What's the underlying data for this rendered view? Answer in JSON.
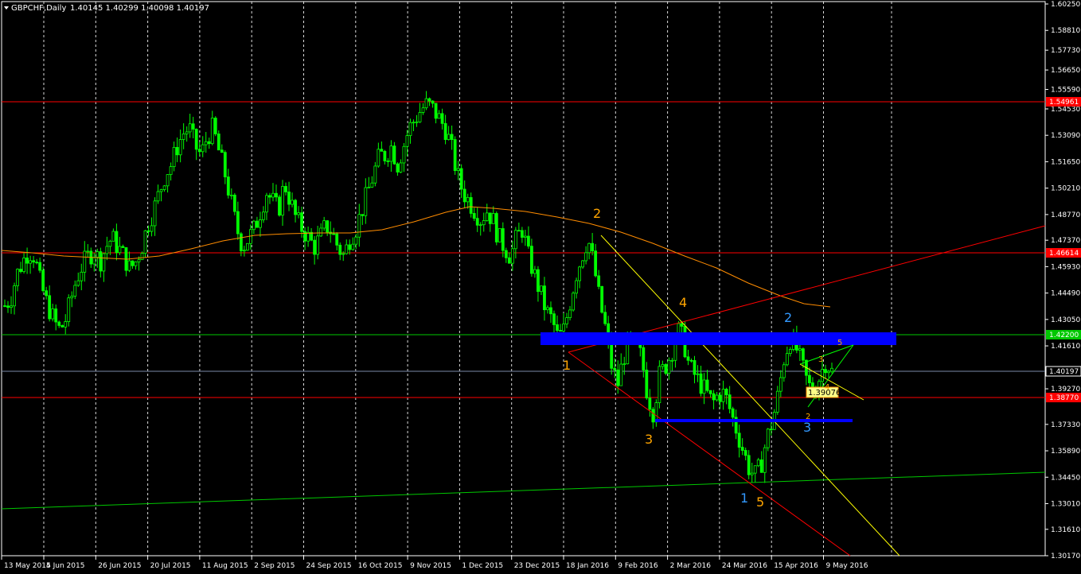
{
  "header": {
    "symbol_label": "GBPCHF,Daily",
    "ohlc": "1.40145 1.40299 1.40098 1.40197"
  },
  "colors": {
    "background": "#000000",
    "grid": "#ffffff",
    "candle": "#00ff00",
    "red_line": "#ff0000",
    "green_line": "#00c800",
    "yellow_line": "#ffff00",
    "ma_line": "#ff8c00",
    "blue_zone": "#0000ff",
    "wave_orange": "#ffa500",
    "wave_blue": "#3399ff",
    "current_price_line": "#7a8aa8"
  },
  "chart_data": {
    "type": "candlestick",
    "symbol": "GBPCHF",
    "timeframe": "Daily",
    "ohlc_last": {
      "open": 1.40145,
      "high": 1.40299,
      "low": 1.40098,
      "close": 1.40197
    },
    "y_ticks": [
      "1.60250",
      "1.58810",
      "1.57730",
      "1.56650",
      "1.55590",
      "1.54530",
      "1.53090",
      "1.51650",
      "1.50210",
      "1.48770",
      "1.47370",
      "1.45930",
      "1.44490",
      "1.43050",
      "1.41610",
      "1.40197",
      "1.39270",
      "1.37330",
      "1.35890",
      "1.34450",
      "1.33010",
      "1.31610",
      "1.30170"
    ],
    "x_ticks": [
      "13 May 2015",
      "4 Jun 2015",
      "26 Jun 2015",
      "20 Jul 2015",
      "11 Aug 2015",
      "2 Sep 2015",
      "24 Sep 2015",
      "16 Oct 2015",
      "9 Nov 2015",
      "1 Dec 2015",
      "23 Dec 2015",
      "18 Jan 2016",
      "9 Feb 2016",
      "2 Mar 2016",
      "24 Mar 2016",
      "15 Apr 2016",
      "9 May 2016"
    ],
    "price_labels": {
      "upper_red": "1.54961",
      "mid_red": "1.46614",
      "green": "1.42200",
      "current": "1.40197",
      "lower_red": "1.38770"
    },
    "close_series": [
      1.438,
      1.442,
      1.455,
      1.462,
      1.468,
      1.465,
      1.45,
      1.44,
      1.432,
      1.425,
      1.428,
      1.44,
      1.452,
      1.46,
      1.465,
      1.468,
      1.462,
      1.47,
      1.475,
      1.47,
      1.465,
      1.458,
      1.462,
      1.47,
      1.482,
      1.49,
      1.5,
      1.51,
      1.515,
      1.525,
      1.532,
      1.535,
      1.525,
      1.52,
      1.53,
      1.535,
      1.522,
      1.51,
      1.495,
      1.48,
      1.47,
      1.475,
      1.48,
      1.49,
      1.5,
      1.495,
      1.49,
      1.505,
      1.495,
      1.485,
      1.48,
      1.475,
      1.47,
      1.475,
      1.482,
      1.478,
      1.47,
      1.465,
      1.475,
      1.48,
      1.49,
      1.5,
      1.51,
      1.52,
      1.52,
      1.525,
      1.515,
      1.525,
      1.535,
      1.54,
      1.545,
      1.548,
      1.545,
      1.54,
      1.535,
      1.525,
      1.51,
      1.5,
      1.495,
      1.49,
      1.485,
      1.49,
      1.485,
      1.475,
      1.47,
      1.465,
      1.475,
      1.48,
      1.465,
      1.455,
      1.445,
      1.435,
      1.43,
      1.42,
      1.425,
      1.44,
      1.455,
      1.465,
      1.475,
      1.46,
      1.44,
      1.425,
      1.405,
      1.395,
      1.41,
      1.42,
      1.415,
      1.41,
      1.39,
      1.38,
      1.4,
      1.405,
      1.412,
      1.425,
      1.42,
      1.405,
      1.4,
      1.395,
      1.39,
      1.385,
      1.39,
      1.39,
      1.38,
      1.37,
      1.36,
      1.35,
      1.345,
      1.35,
      1.365,
      1.375,
      1.39,
      1.41,
      1.42,
      1.415,
      1.405,
      1.395,
      1.39,
      1.4,
      1.408,
      1.402
    ],
    "waves": {
      "orange": [
        {
          "label": "1",
          "x_date": "18 Jan 2016",
          "price": 1.4115
        },
        {
          "label": "2",
          "x_date": "28 Jan 2016",
          "price": 1.484
        },
        {
          "label": "3",
          "x_date": "15 Feb 2016",
          "price": 1.368
        },
        {
          "label": "4",
          "x_date": "4 Mar 2016",
          "price": 1.441
        },
        {
          "label": "5",
          "x_date": "30 Mar 2016",
          "price": 1.332
        }
      ],
      "blue": [
        {
          "label": "1",
          "x_date": "28 Mar 2016",
          "price": 1.334
        },
        {
          "label": "2",
          "x_date": "15 Apr 2016",
          "price": 1.432
        },
        {
          "label": "3",
          "x_date": "2 May 2016",
          "price": 1.372
        }
      ],
      "small_orange": [
        {
          "label": "2",
          "price": 1.379
        },
        {
          "label": "3",
          "price": 1.407
        },
        {
          "label": "4",
          "price": 1.396
        },
        {
          "label": "5",
          "price": 1.417
        }
      ]
    },
    "box_label": "1.39076"
  }
}
